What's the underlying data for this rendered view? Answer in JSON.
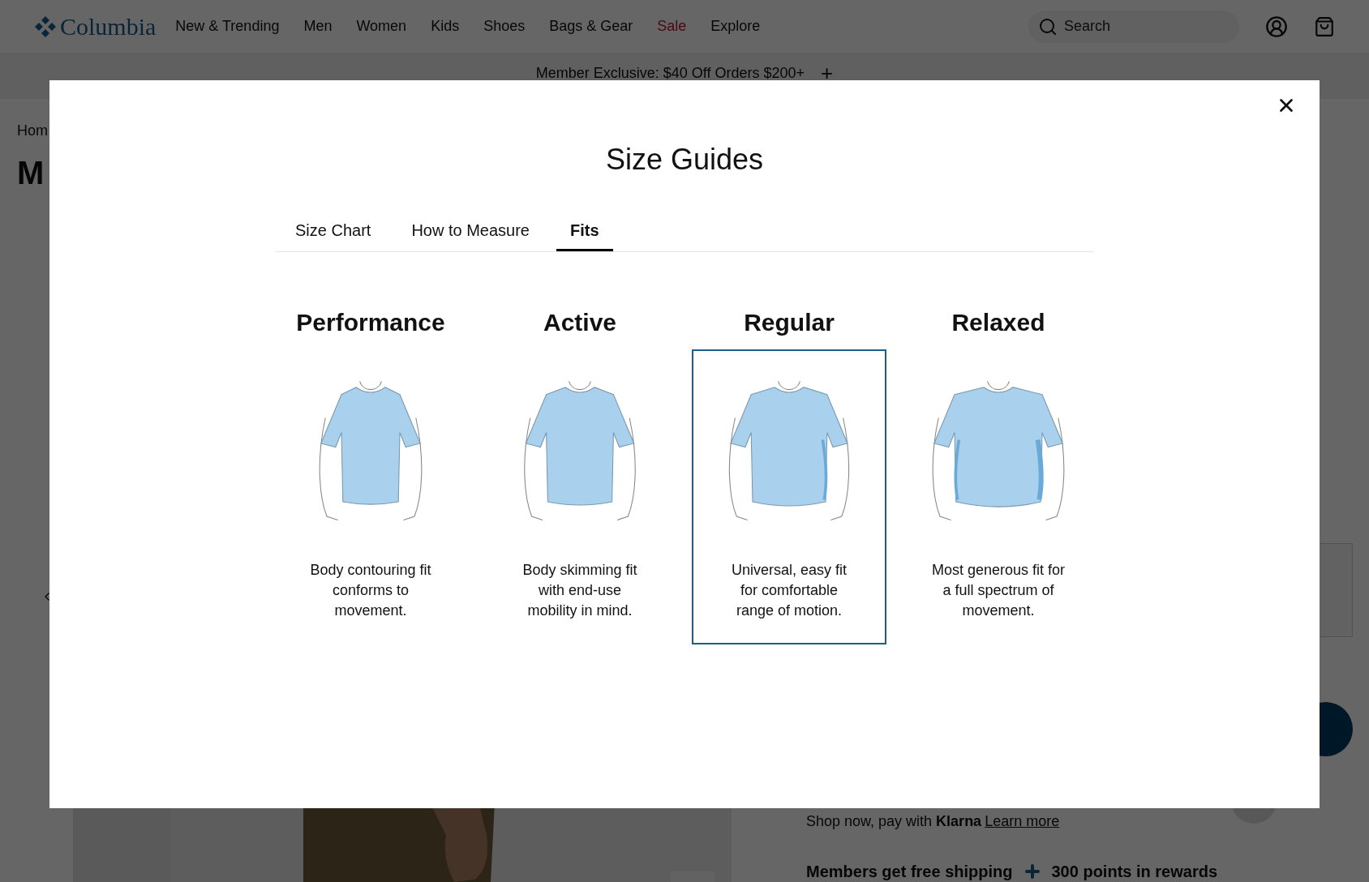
{
  "header": {
    "brand": "Columbia",
    "nav": [
      {
        "label": "New & Trending",
        "kind": "link"
      },
      {
        "label": "Men",
        "kind": "link"
      },
      {
        "label": "Women",
        "kind": "link"
      },
      {
        "label": "Kids",
        "kind": "link"
      },
      {
        "label": "Shoes",
        "kind": "link"
      },
      {
        "label": "Bags & Gear",
        "kind": "link"
      },
      {
        "label": "Sale",
        "kind": "sale"
      },
      {
        "label": "Explore",
        "kind": "link"
      }
    ],
    "search": {
      "placeholder": "Search"
    }
  },
  "promo_banner": {
    "text": "Member Exclusive: $40 Off Orders $200+",
    "toggle": "+"
  },
  "page": {
    "breadcrumb": "Hom",
    "title": "M",
    "payment": {
      "text": "Shop now, pay with **Klarna**",
      "link": "Learn more"
    },
    "members": {
      "text": "Members get free shipping",
      "extra": "300 points in rewards"
    }
  },
  "dialog": {
    "title": "Size Guides",
    "tabs": [
      {
        "label": "Size Chart",
        "selected": false
      },
      {
        "label": "How to Measure",
        "selected": false
      },
      {
        "label": "Fits",
        "selected": true
      }
    ],
    "fits": [
      {
        "name": "Performance",
        "kind": "performance",
        "description": "Body contouring fit conforms to movement.",
        "selected": false
      },
      {
        "name": "Active",
        "kind": "active",
        "description": "Body skimming fit with end-use mobility in mind.",
        "selected": false
      },
      {
        "name": "Regular",
        "kind": "regular",
        "description": "Universal, easy fit for comfortable range of motion.",
        "selected": true
      },
      {
        "name": "Relaxed",
        "kind": "relaxed",
        "description": "Most generous fit for a full spectrum of movement.",
        "selected": false
      }
    ]
  }
}
